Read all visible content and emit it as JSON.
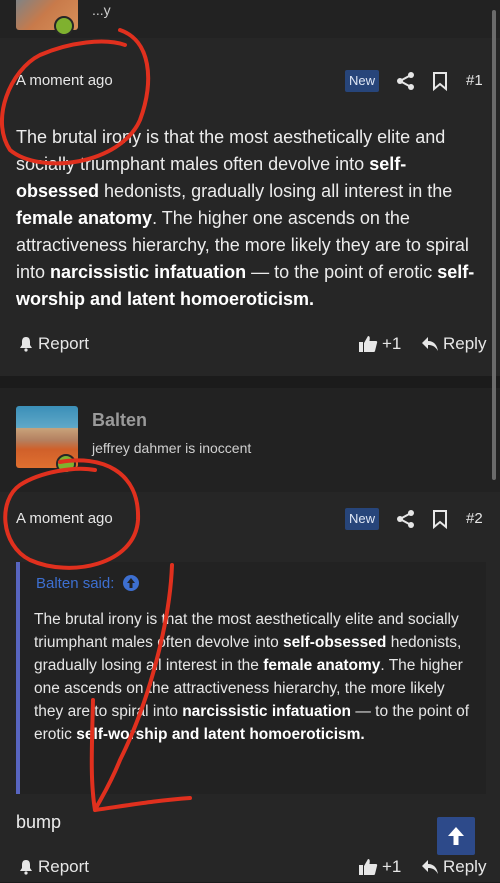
{
  "post1": {
    "user_status_partial": "...y",
    "time": "A moment ago",
    "badge": "New",
    "number": "#1",
    "message_parts": [
      {
        "t": "The brutal irony is that the most aesthetically elite and socially triumphant males often devolve into ",
        "b": false
      },
      {
        "t": "self-obsessed",
        "b": true
      },
      {
        "t": " hedonists, gradually losing all interest in the ",
        "b": false
      },
      {
        "t": "female anatomy",
        "b": true
      },
      {
        "t": ". The higher one ascends on the attractiveness hierarchy, the more likely they are to spiral into ",
        "b": false
      },
      {
        "t": "narcissistic infatuation",
        "b": true
      },
      {
        "t": " — to the point of erotic ",
        "b": false
      },
      {
        "t": "self-worship and latent homoeroticism.",
        "b": true
      }
    ],
    "report_label": "Report",
    "like_count": "+1",
    "reply_label": "Reply"
  },
  "post2": {
    "username": "Balten",
    "user_title": "jeffrey dahmer is inoccent",
    "time": "A moment ago",
    "badge": "New",
    "number": "#2",
    "quote_author": "Balten said:",
    "quote_parts": [
      {
        "t": "The brutal irony is that the most aesthetically elite and socially triumphant males often devolve into ",
        "b": false
      },
      {
        "t": "self-obsessed",
        "b": true
      },
      {
        "t": " hedonists, gradually losing all interest in the ",
        "b": false
      },
      {
        "t": "female anatomy",
        "b": true
      },
      {
        "t": ". The higher one ascends on the attractiveness hierarchy, the more likely they are to spiral into ",
        "b": false
      },
      {
        "t": "narcissistic infatuation",
        "b": true
      },
      {
        "t": " — to the point of erotic ",
        "b": false
      },
      {
        "t": "self-worship and latent homoeroticism.",
        "b": true
      }
    ],
    "body": "bump",
    "report_label": "Report",
    "like_count": "+1",
    "reply_label": "Reply"
  },
  "colors": {
    "accent": "#27457a",
    "quote_border": "#5865c0",
    "online": "#7fb12f",
    "annotation": "#e0301e"
  },
  "icons": [
    "share-icon",
    "bookmark-icon",
    "bell-icon",
    "thumbs-up-icon",
    "reply-icon",
    "arrow-up-icon",
    "circle-arrow-up-icon"
  ]
}
